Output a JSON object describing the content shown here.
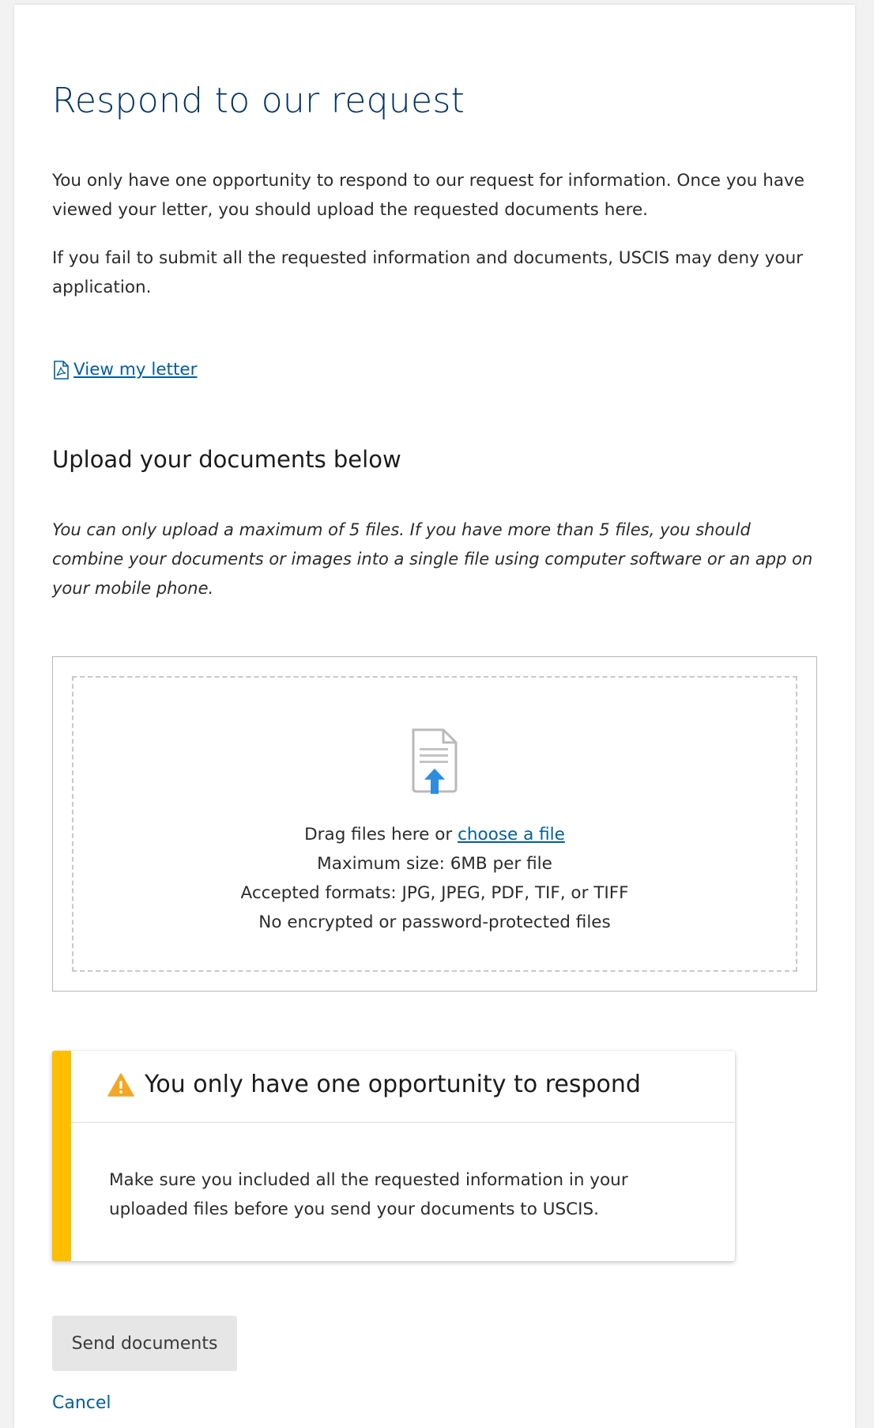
{
  "page": {
    "title": "Respond to our request",
    "intro_1": "You only have one opportunity to respond to our request for information. Once you have viewed your letter, you should upload the requested documents here.",
    "intro_2": "If you fail to submit all the requested information and documents, USCIS may deny your application.",
    "view_letter_label": "View my letter"
  },
  "upload": {
    "heading": "Upload your documents below",
    "hint": "You can only upload a maximum of 5 files. If you have more than 5 files, you should combine your documents or images into a single file using computer software or an app on your mobile phone.",
    "drag_text": "Drag files here or ",
    "choose_link": "choose a file",
    "max_size": "Maximum size: 6MB per file",
    "formats": "Accepted formats: JPG, JPEG, PDF, TIF, or TIFF",
    "encryption_note": "No encrypted or password-protected files"
  },
  "alert": {
    "title": "You only have one opportunity to respond",
    "body": "Make sure you included all the requested information in your uploaded files before you send your documents to USCIS."
  },
  "actions": {
    "send_label": "Send documents",
    "cancel_label": "Cancel"
  },
  "colors": {
    "heading": "#003366",
    "link": "#005ea2",
    "alert_bar": "#ffbe00",
    "upload_arrow": "#2e8de0"
  },
  "icons": {
    "letter_link": "pdf-file-icon",
    "dropzone": "file-upload-icon",
    "alert": "warning-icon"
  }
}
